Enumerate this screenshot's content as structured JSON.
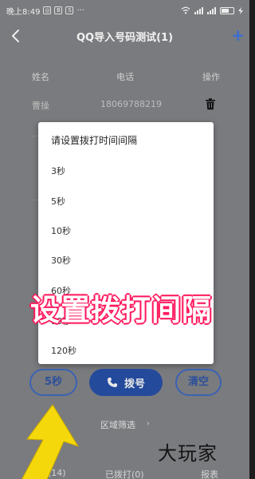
{
  "statusbar": {
    "time": "晚上8:49",
    "badges": [
      "◎",
      "B",
      "S"
    ],
    "dots": "···"
  },
  "header": {
    "title": "QQ导入号码测试(1)",
    "back_icon": "chevron-left-icon",
    "add_label": "+"
  },
  "table": {
    "columns": [
      "姓名",
      "电话",
      "操作"
    ],
    "rows": [
      {
        "name": "曹操",
        "phone": "18069788219"
      }
    ]
  },
  "dialog": {
    "title": "请设置拨打时间间隔",
    "options": [
      "3秒",
      "5秒",
      "10秒",
      "30秒",
      "60秒",
      "90秒",
      "120秒"
    ]
  },
  "actions": {
    "interval_label": "5秒",
    "dial_label": "拨号",
    "clear_label": "清空"
  },
  "region_filter": {
    "label": "区域筛选",
    "arrow": "›"
  },
  "tabs": [
    "(14)",
    "已拨打(0)",
    "报表"
  ],
  "overlay": {
    "caption": "设置拨打间隔"
  },
  "watermark": {
    "text": "大玩家"
  },
  "colors": {
    "accent": "#244a9c",
    "caption_outline": "#ff1a5e",
    "arrow": "#f5d80b"
  }
}
